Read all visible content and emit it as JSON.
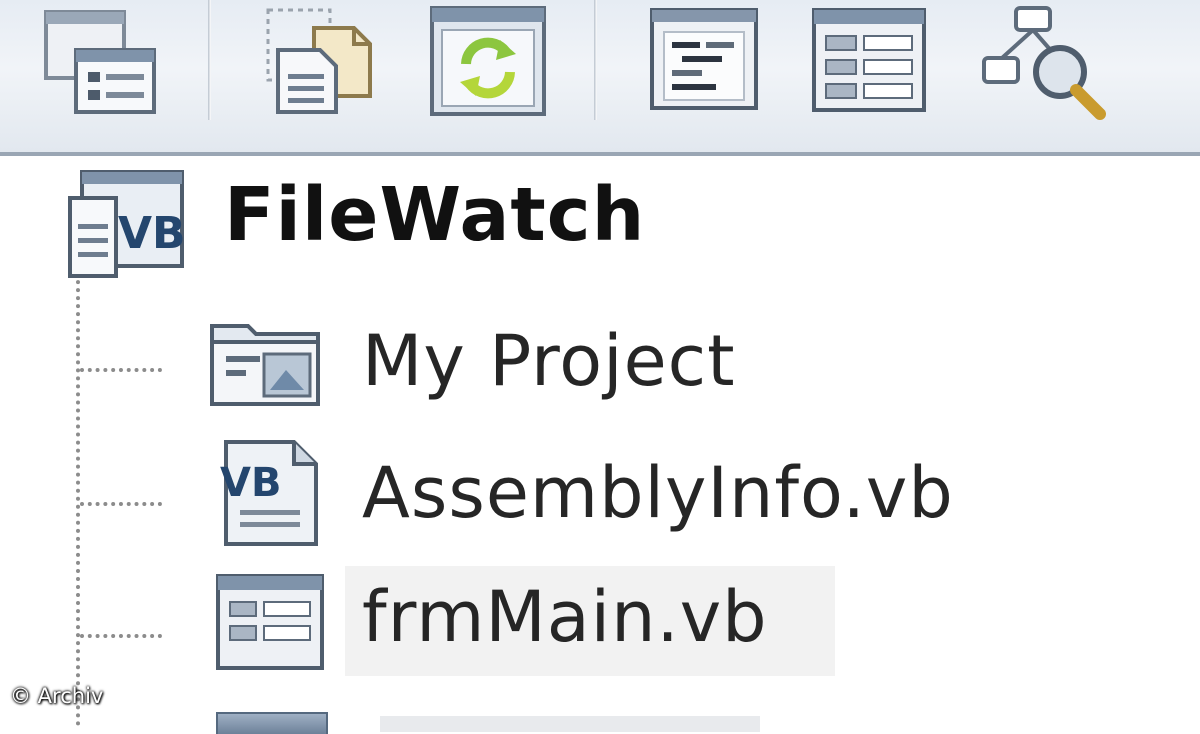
{
  "toolbar": {
    "buttons": [
      {
        "name": "properties-icon"
      },
      {
        "name": "show-all-files-icon"
      },
      {
        "name": "refresh-icon"
      },
      {
        "name": "view-code-icon"
      },
      {
        "name": "view-designer-icon"
      },
      {
        "name": "class-diagram-icon"
      }
    ]
  },
  "tree": {
    "root": {
      "label": "FileWatch",
      "icon": "vb-project-icon"
    },
    "children": [
      {
        "label": "My Project",
        "icon": "my-project-icon"
      },
      {
        "label": "AssemblyInfo.vb",
        "icon": "vb-file-icon"
      },
      {
        "label": "frmMain.vb",
        "icon": "form-icon",
        "selected": true
      }
    ]
  },
  "watermark": "© Archiv",
  "colors": {
    "toolbar_bg": "#e6ecf3",
    "tree_line": "#8c8c8c",
    "icon_blue": "#6d8199",
    "refresh_green": "#8cc63f",
    "selection_bg": "#f2f2f2"
  }
}
